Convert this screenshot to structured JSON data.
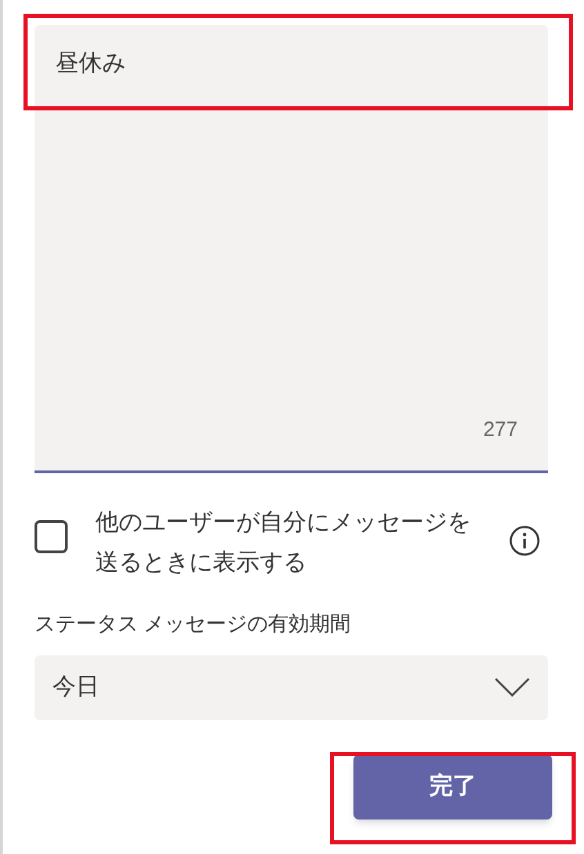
{
  "status_message": {
    "value": "昼休み",
    "remaining": "277",
    "highlighted": true
  },
  "show_when_messaging": {
    "label": "他のユーザーが自分にメッセージを送るときに表示する",
    "checked": false
  },
  "expiry": {
    "label": "ステータス メッセージの有効期間",
    "value": "今日"
  },
  "done_button": {
    "label": "完了",
    "highlighted": true
  }
}
